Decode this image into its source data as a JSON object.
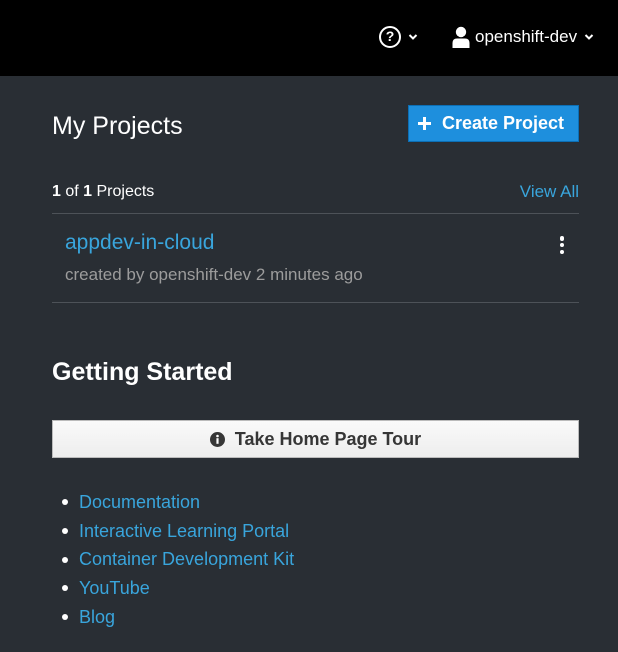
{
  "header": {
    "help_icon": "question-circle-icon",
    "user_icon": "user-icon",
    "username": "openshift-dev"
  },
  "projects": {
    "heading": "My Projects",
    "create_label": "Create Project",
    "count_current": "1",
    "count_of": " of ",
    "count_total": "1",
    "count_suffix": " Projects",
    "view_all": "View All",
    "items": [
      {
        "name": "appdev-in-cloud",
        "meta": "created by openshift-dev 2 minutes ago"
      }
    ]
  },
  "getting_started": {
    "heading": "Getting Started",
    "tour_label": "Take Home Page Tour",
    "links": [
      "Documentation",
      "Interactive Learning Portal",
      "Container Development Kit",
      "YouTube",
      "Blog"
    ]
  },
  "colors": {
    "topbar": "#000000",
    "background": "#292e34",
    "accent": "#1e8fdd",
    "link": "#39a5dc"
  }
}
